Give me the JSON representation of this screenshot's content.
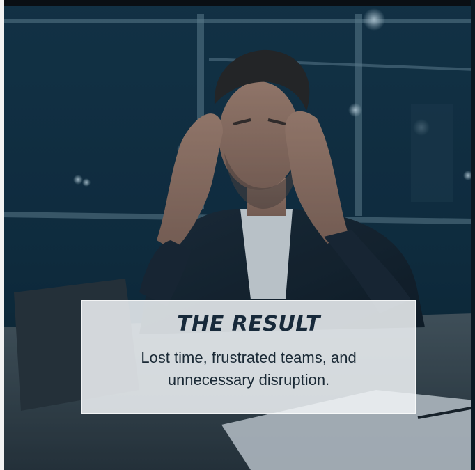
{
  "photo": {
    "subject": "stressed-man-at-desk-photo",
    "overlay_color": "#0d2b3e"
  },
  "caption": {
    "title": "THE RESULT",
    "body": "Lost time, frustrated teams, and unnecessary disruption.",
    "title_color": "#17293a",
    "background_color": "#eef1f4"
  }
}
